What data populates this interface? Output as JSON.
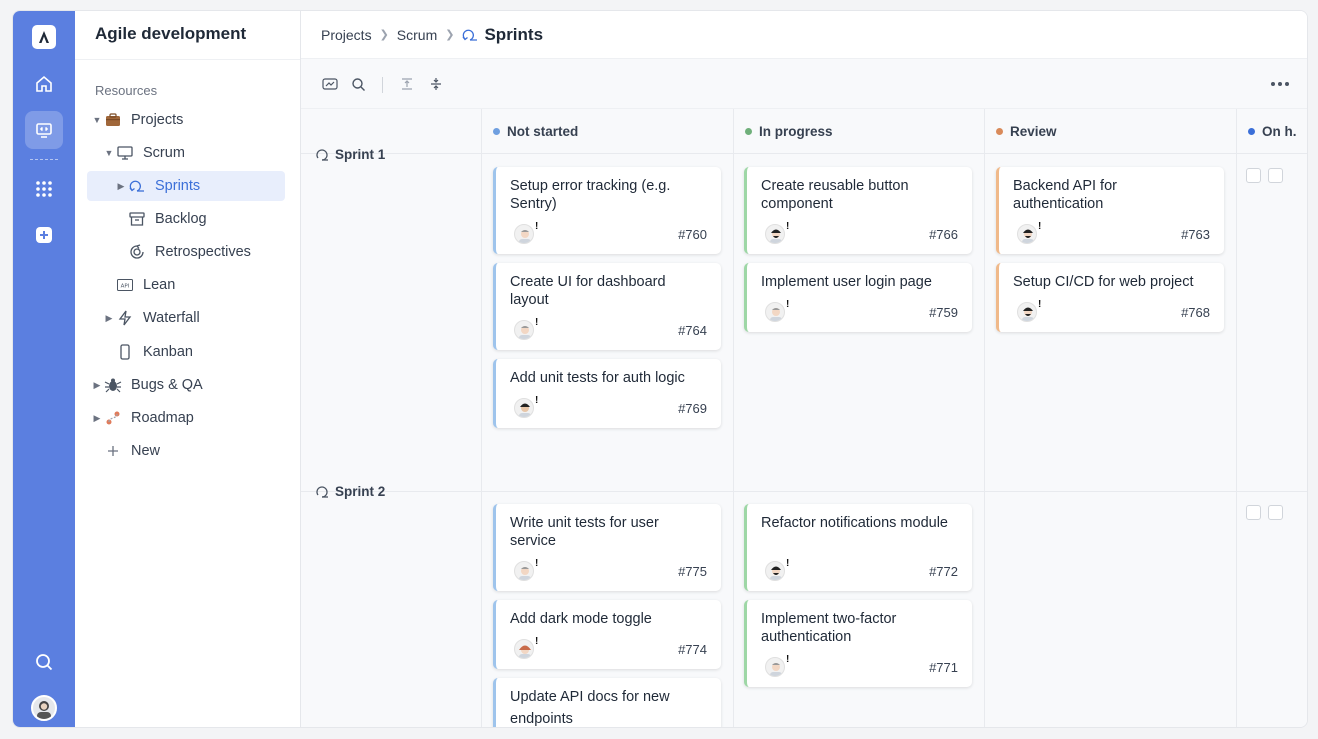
{
  "sidebar": {
    "title": "Agile development",
    "section_label": "Resources",
    "items": [
      {
        "label": "Projects"
      },
      {
        "label": "Scrum"
      },
      {
        "label": "Sprints"
      },
      {
        "label": "Backlog"
      },
      {
        "label": "Retrospectives"
      },
      {
        "label": "Lean"
      },
      {
        "label": "Waterfall"
      },
      {
        "label": "Kanban"
      },
      {
        "label": "Bugs & QA"
      },
      {
        "label": "Roadmap"
      },
      {
        "label": "New"
      }
    ]
  },
  "breadcrumb": {
    "items": [
      "Projects",
      "Scrum"
    ],
    "current": "Sprints"
  },
  "columns": [
    {
      "label": "Not started",
      "color": "#6f9fe0"
    },
    {
      "label": "In progress",
      "color": "#6faf7a"
    },
    {
      "label": "Review",
      "color": "#d98a5a"
    },
    {
      "label": "On h.",
      "color": "#3b6fd8"
    }
  ],
  "sprints": [
    {
      "label": "Sprint 1",
      "not_started": [
        {
          "title": "Setup error tracking (e.g. Sentry)",
          "id": "#760",
          "bang": "!"
        },
        {
          "title": "Create UI for dashboard layout",
          "id": "#764",
          "bang": "!"
        },
        {
          "title": "Add unit tests for auth logic",
          "id": "#769",
          "bang": "!"
        }
      ],
      "in_progress": [
        {
          "title": "Create reusable button component",
          "id": "#766",
          "bang": "!"
        },
        {
          "title": "Implement user login page",
          "id": "#759",
          "bang": "!"
        }
      ],
      "review": [
        {
          "title": "Backend API for authentication",
          "id": "#763",
          "bang": "!"
        },
        {
          "title": "Setup CI/CD for web project",
          "id": "#768",
          "bang": "!"
        }
      ]
    },
    {
      "label": "Sprint 2",
      "not_started": [
        {
          "title": "Write unit tests for user service",
          "id": "#775",
          "bang": "!"
        },
        {
          "title": "Add dark mode toggle",
          "id": "#774",
          "bang": "!"
        },
        {
          "title": "Update API docs for new endpoints",
          "id": "",
          "bang": ""
        }
      ],
      "in_progress": [
        {
          "title": "Refactor notifications module",
          "id": "#772",
          "bang": "!"
        },
        {
          "title": "Implement two-factor authentication",
          "id": "#771",
          "bang": "!"
        }
      ],
      "review": []
    }
  ]
}
